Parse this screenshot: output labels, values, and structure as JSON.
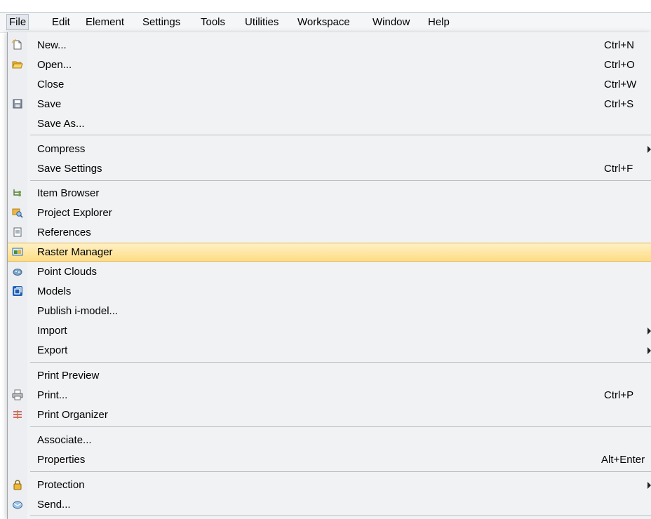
{
  "menubar": {
    "items": [
      "File",
      "Edit",
      "Element",
      "Settings",
      "Tools",
      "Utilities",
      "Workspace",
      "Window",
      "Help"
    ]
  },
  "file_menu": {
    "new": {
      "label": "New...",
      "shortcut": "Ctrl+N"
    },
    "open": {
      "label": "Open...",
      "shortcut": "Ctrl+O"
    },
    "close": {
      "label": "Close",
      "shortcut": "Ctrl+W"
    },
    "save": {
      "label": "Save",
      "shortcut": "Ctrl+S"
    },
    "save_as": {
      "label": "Save As..."
    },
    "compress": {
      "label": "Compress"
    },
    "save_settings": {
      "label": "Save Settings",
      "shortcut": "Ctrl+F"
    },
    "item_browser": {
      "label": "Item Browser"
    },
    "project_explorer": {
      "label": "Project Explorer"
    },
    "references": {
      "label": "References"
    },
    "raster_manager": {
      "label": "Raster Manager"
    },
    "point_clouds": {
      "label": "Point Clouds"
    },
    "models": {
      "label": "Models"
    },
    "publish": {
      "label": "Publish i-model..."
    },
    "import": {
      "label": "Import"
    },
    "export": {
      "label": "Export"
    },
    "print_preview": {
      "label": "Print Preview"
    },
    "print": {
      "label": "Print...",
      "shortcut": "Ctrl+P"
    },
    "print_organizer": {
      "label": "Print Organizer"
    },
    "associate": {
      "label": "Associate..."
    },
    "properties": {
      "label": "Properties",
      "shortcut": "Alt+Enter"
    },
    "protection": {
      "label": "Protection"
    },
    "send": {
      "label": "Send..."
    }
  },
  "colors": {
    "highlight_top": "#fff1c6",
    "highlight_bottom": "#fddc84",
    "highlight_border": "#e3b64b",
    "menu_background": "#f1f2f4"
  }
}
